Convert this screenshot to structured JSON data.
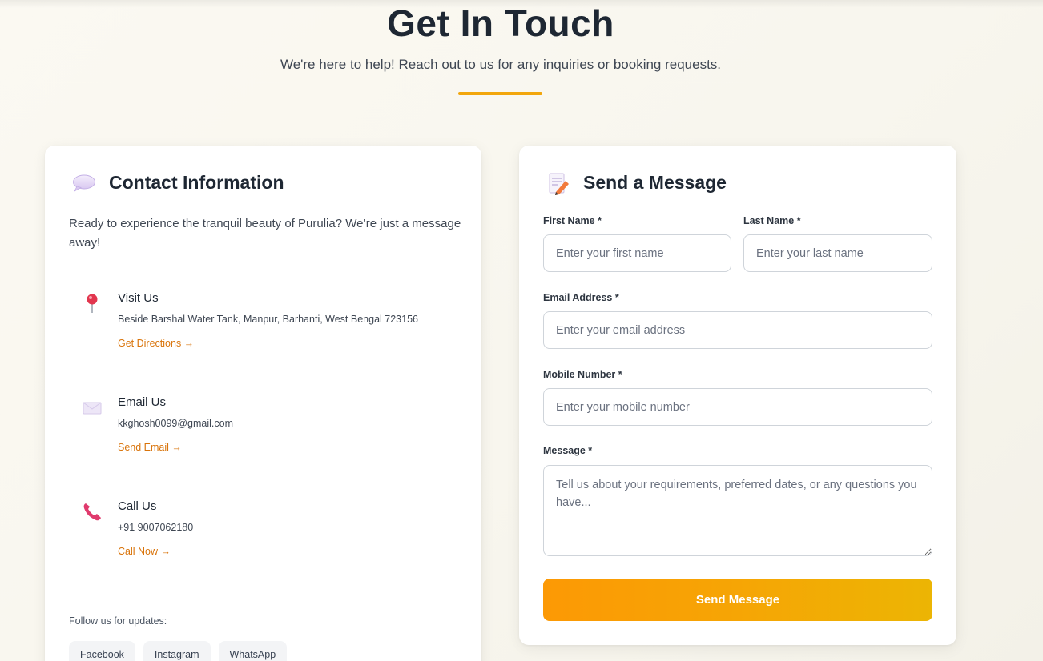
{
  "header": {
    "title": "Get In Touch",
    "subtitle": "We're here to help! Reach out to us for any inquiries or booking requests."
  },
  "contact_info": {
    "heading": "Contact Information",
    "heading_icon": "speech-bubble-icon",
    "intro": "Ready to experience the tranquil beauty of Purulia? We’re just a message away!",
    "items": [
      {
        "icon": "round-pushpin-icon",
        "title": "Visit Us",
        "detail": "Beside Barshal Water Tank, Manpur, Barhanti, West Bengal 723156",
        "link": "Get Directions →"
      },
      {
        "icon": "envelope-icon",
        "title": "Email Us",
        "detail": "kkghosh0099@gmail.com",
        "link": "Send Email →"
      },
      {
        "icon": "telephone-receiver-icon",
        "title": "Call Us",
        "detail": "+91 9007062180",
        "link": "Call Now →"
      }
    ],
    "follow_label": "Follow us for updates:",
    "socials": [
      "Facebook",
      "Instagram",
      "WhatsApp"
    ]
  },
  "form": {
    "heading": "Send a Message",
    "heading_icon": "memo-icon",
    "first_name": {
      "label": "First Name *",
      "placeholder": "Enter your first name",
      "value": ""
    },
    "last_name": {
      "label": "Last Name *",
      "placeholder": "Enter your last name",
      "value": ""
    },
    "email": {
      "label": "Email Address *",
      "placeholder": "Enter your email address",
      "value": ""
    },
    "mobile": {
      "label": "Mobile Number *",
      "placeholder": "Enter your mobile number",
      "value": ""
    },
    "message": {
      "label": "Message *",
      "placeholder": "Tell us about your requirements, preferred dates, or any questions you have...",
      "value": ""
    },
    "submit_label": "Send Message"
  },
  "colors": {
    "accent": "#f2a60c",
    "link": "#d9740b",
    "button_start": "#fc9905",
    "button_end": "#ecb504",
    "heading": "#1e2733"
  }
}
